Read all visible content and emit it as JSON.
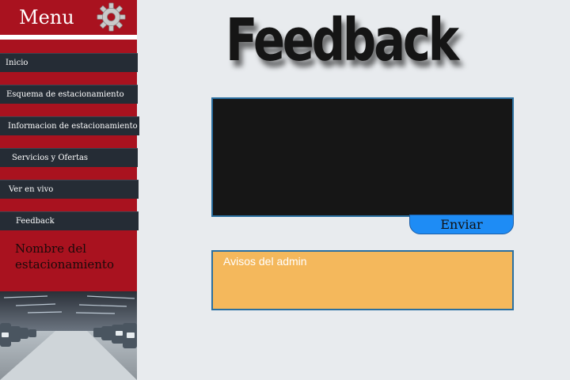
{
  "sidebar": {
    "menu_title": "Menu",
    "items": [
      {
        "label": "Inicio"
      },
      {
        "label": "Esquema de estacionamiento"
      },
      {
        "label": "Informacion de estacionamiento"
      },
      {
        "label": "Servicios y Ofertas"
      },
      {
        "label": "Ver en vivo"
      },
      {
        "label": "Feedback"
      }
    ],
    "lot_name": "Nombre del estacionamiento"
  },
  "main": {
    "heading": "Feedback",
    "send_label": "Enviar",
    "notices_label": "Avisos del admin"
  },
  "colors": {
    "sidebar_red": "#a9121f",
    "nav_dark": "#252c35",
    "send_blue": "#1e8cf5",
    "notice_orange": "#f4b85c",
    "background": "#e8ebee"
  }
}
